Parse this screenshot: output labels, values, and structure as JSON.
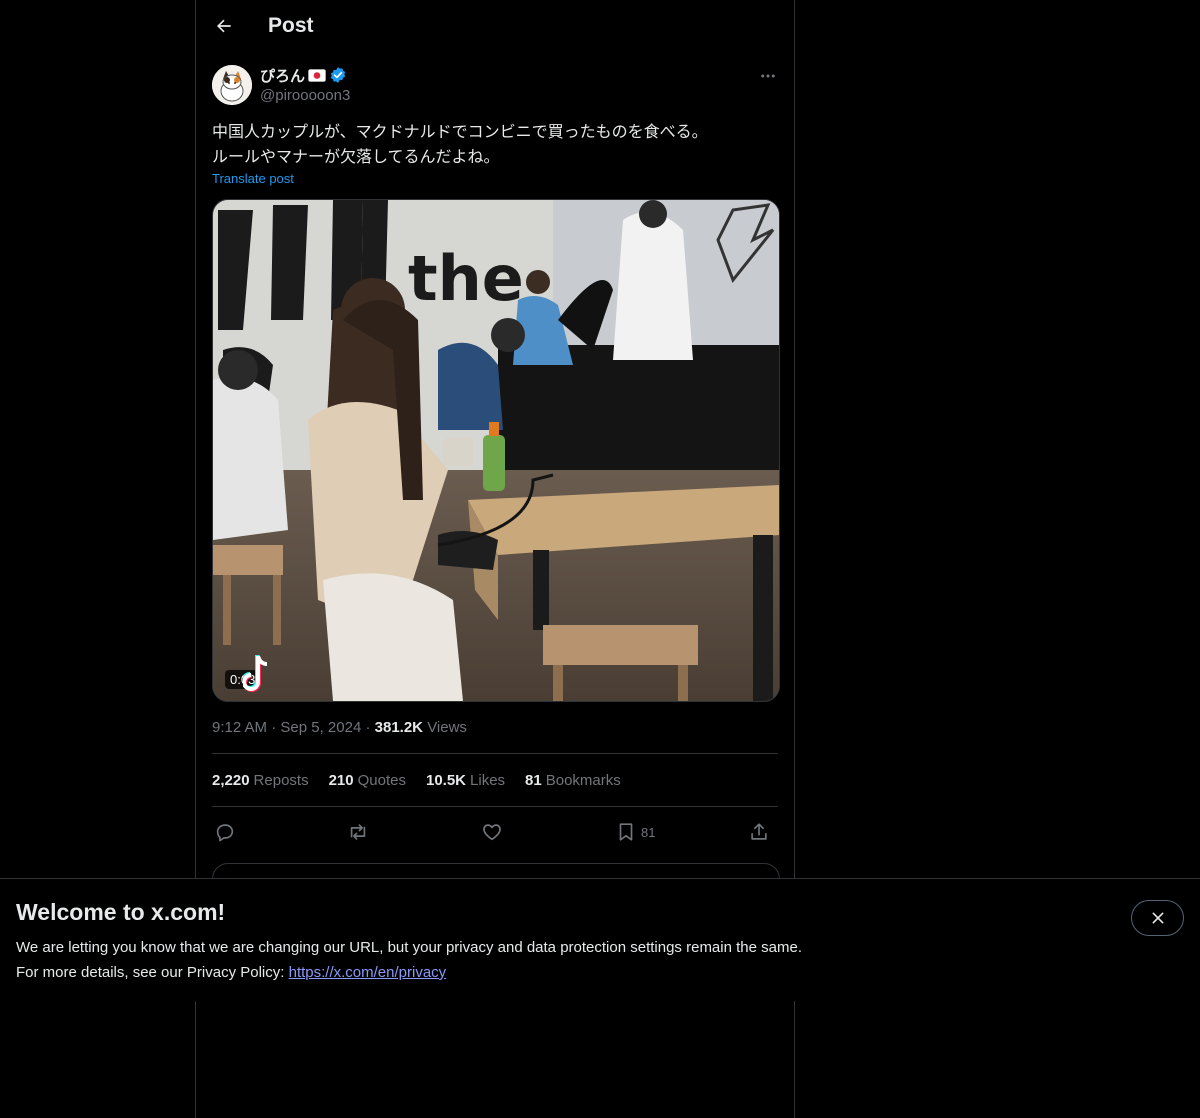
{
  "header": {
    "title": "Post"
  },
  "post": {
    "display_name": "ぴろん",
    "handle": "@pirooooon3",
    "text": "中国人カップルが、マクドナルドでコンビニで買ったものを食べる。\nルールやマナーが欠落してるんだよね。",
    "translate_label": "Translate post",
    "video_duration": "0:03",
    "time": "9:12 AM",
    "date": "Sep 5, 2024",
    "views_count": "381.2K",
    "views_label": "Views"
  },
  "stats": {
    "reposts_count": "2,220",
    "reposts_label": "Reposts",
    "quotes_count": "210",
    "quotes_label": "Quotes",
    "likes_count": "10.5K",
    "likes_label": "Likes",
    "bookmarks_count": "81",
    "bookmarks_label": "Bookmarks"
  },
  "actions": {
    "bookmark_count": "81"
  },
  "banner": {
    "title": "Welcome to x.com!",
    "line1": "We are letting you know that we are changing our URL, but your privacy and data protection settings remain the same.",
    "line2_prefix": "For more details, see our Privacy Policy:",
    "privacy_link": "https://x.com/en/privacy"
  },
  "icons": {
    "back": "arrow-left-icon",
    "verified": "verified-badge-icon",
    "flag": "japan-flag-icon",
    "more": "more-dots-icon",
    "reply": "reply-icon",
    "repost": "repost-icon",
    "like": "heart-icon",
    "bookmark": "bookmark-icon",
    "share": "share-icon",
    "close": "close-icon",
    "tiktok": "tiktok-logo-icon"
  },
  "colors": {
    "background": "#000000",
    "text": "#e7e9ea",
    "muted": "#71767b",
    "accent": "#1d9bf0",
    "border": "#2f3336",
    "link": "#8b98f9"
  }
}
